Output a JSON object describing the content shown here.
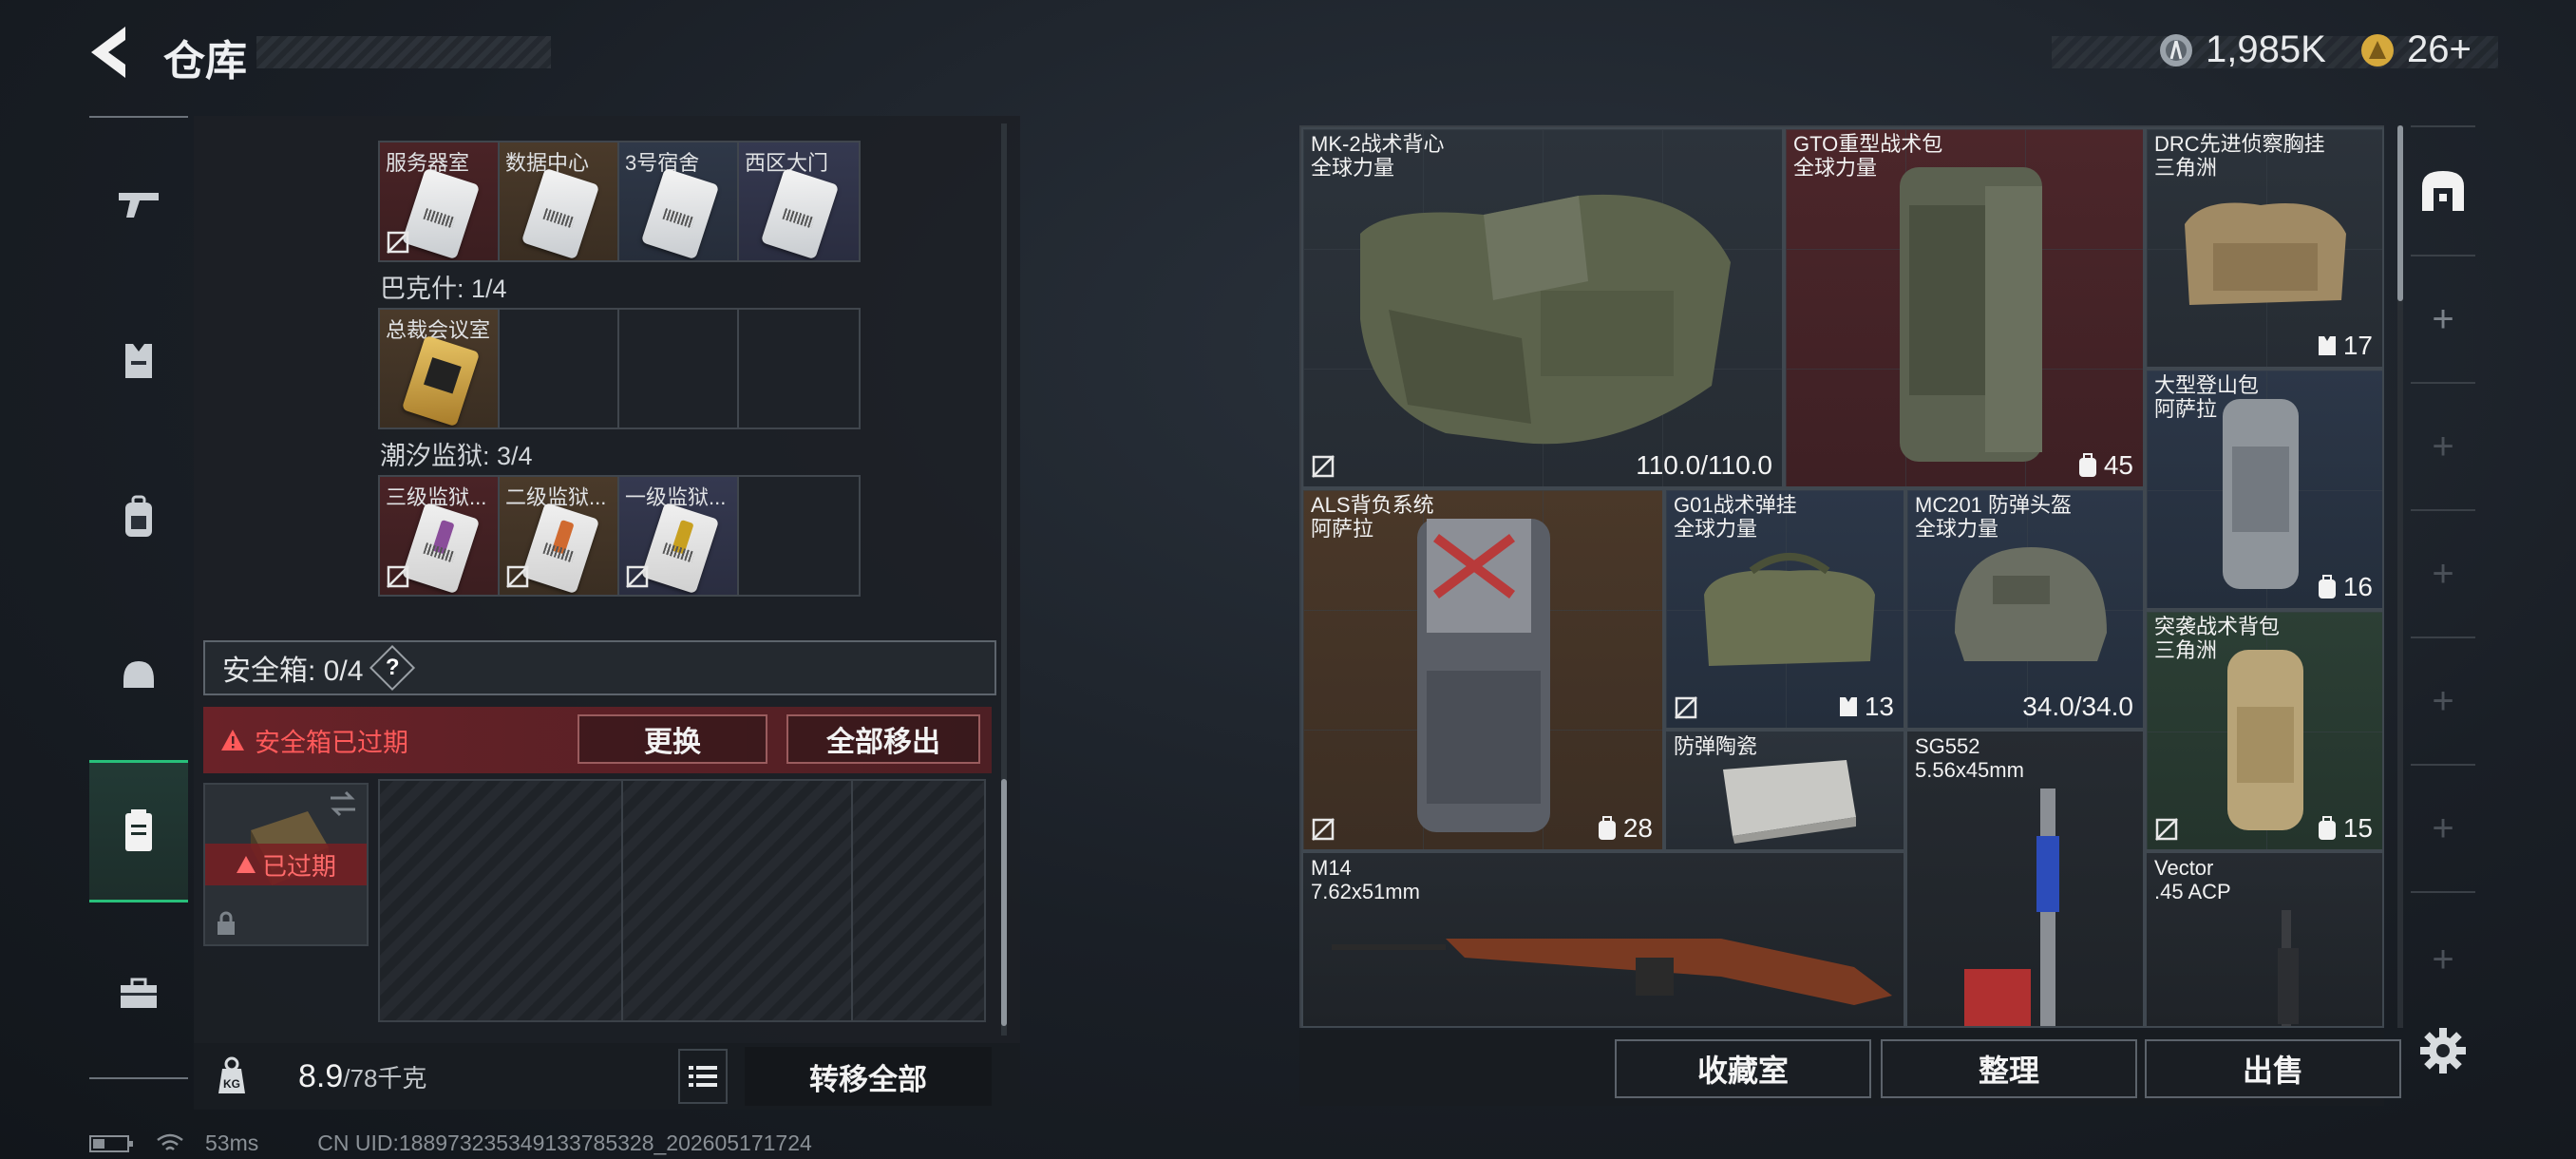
{
  "header": {
    "title": "仓库",
    "currency1": "1,985K",
    "currency2": "26+"
  },
  "left": {
    "groups": [
      {
        "slots": [
          {
            "label": "服务器室",
            "color": "red",
            "noentry": true
          },
          {
            "label": "数据中心",
            "color": "brown",
            "noentry": false
          },
          {
            "label": "3号宿舍",
            "color": "blue",
            "noentry": false
          },
          {
            "label": "西区大门",
            "color": "purple",
            "noentry": false
          }
        ]
      },
      {
        "title": "巴克什: 1/4",
        "slots": [
          {
            "label": "总裁会议室",
            "color": "brown",
            "noentry": false
          }
        ]
      },
      {
        "title": "潮汐监狱: 3/4",
        "slots": [
          {
            "label": "三级监狱...",
            "color": "red",
            "noentry": true
          },
          {
            "label": "二级监狱...",
            "color": "brown",
            "noentry": true
          },
          {
            "label": "一级监狱...",
            "color": "purple",
            "noentry": true
          }
        ]
      }
    ],
    "safe_box_label": "安全箱: 0/4",
    "help": "?",
    "expired_warning": "安全箱已过期",
    "replace_button": "更换",
    "move_all_out_button": "全部移出",
    "expired_badge": "已过期",
    "weight": "8.9",
    "weight_max": "/78千克",
    "transfer_all_button": "转移全部",
    "kg_label": "KG"
  },
  "right": {
    "items": [
      {
        "name": "MK-2战术背心",
        "sub": "全球力量",
        "value": "110.0/110.0",
        "color": "gray",
        "noentry": true
      },
      {
        "name": "GTO重型战术包",
        "sub": "全球力量",
        "value": "45",
        "color": "red",
        "icon": "backpack"
      },
      {
        "name": "DRC先进侦察胸挂",
        "sub": "三角洲",
        "value": "17",
        "color": "gray",
        "icon": "vest"
      },
      {
        "name": "大型登山包",
        "sub": "阿萨拉",
        "value": "16",
        "color": "blue",
        "icon": "backpack"
      },
      {
        "name": "ALS背负系统",
        "sub": "阿萨拉",
        "value": "28",
        "color": "brown",
        "icon": "backpack",
        "noentry": true
      },
      {
        "name": "G01战术弹挂",
        "sub": "全球力量",
        "value": "13",
        "color": "blue",
        "icon": "vest",
        "noentry": true
      },
      {
        "name": "MC201 防弹头盔",
        "sub": "全球力量",
        "value": "34.0/34.0",
        "color": "blue"
      },
      {
        "name": "突袭战术背包",
        "sub": "三角洲",
        "value": "15",
        "color": "green",
        "icon": "backpack",
        "noentry": true
      },
      {
        "name": "防弹陶瓷",
        "sub": "",
        "value": "",
        "color": "gray"
      },
      {
        "name": "SG552",
        "sub": "5.56x45mm",
        "value": "",
        "color": "dark"
      },
      {
        "name": "M14",
        "sub": "7.62x51mm",
        "value": "",
        "color": "dark"
      },
      {
        "name": "Vector",
        "sub": ".45 ACP",
        "value": "",
        "color": "dark"
      }
    ],
    "collection_button": "收藏室",
    "sort_button": "整理",
    "sell_button": "出售"
  },
  "status": {
    "ping": "53ms",
    "uid": "CN UID:18897323534913378532​8_202605171724"
  },
  "colors": {
    "accent_green": "#28c07a",
    "warning_red": "#ff5a5a"
  }
}
